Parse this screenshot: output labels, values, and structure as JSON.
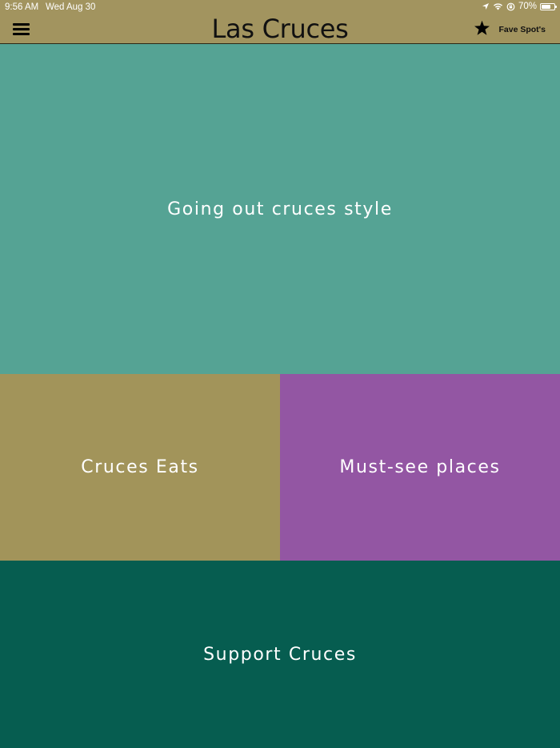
{
  "status_bar": {
    "time": "9:56 AM",
    "date": "Wed Aug 30",
    "battery_percent": "70%",
    "battery_level": 0.7,
    "icons": [
      "location-arrow-icon",
      "wifi-icon",
      "orientation-lock-icon",
      "battery-icon"
    ]
  },
  "nav": {
    "title": "Las Cruces",
    "menu_icon": "hamburger-menu-icon",
    "fave_label": "Fave Spot's",
    "fave_icon": "star-icon"
  },
  "tiles": [
    {
      "label": "Going out cruces style",
      "color": "#55a394"
    },
    {
      "label": "Cruces Eats",
      "color": "#a2945a"
    },
    {
      "label": "Must-see places",
      "color": "#9356a3"
    },
    {
      "label": "Support Cruces",
      "color": "#065d50"
    }
  ],
  "colors": {
    "header_background": "#a2945f",
    "header_text": "#111111",
    "tile_text": "#ffffff"
  }
}
